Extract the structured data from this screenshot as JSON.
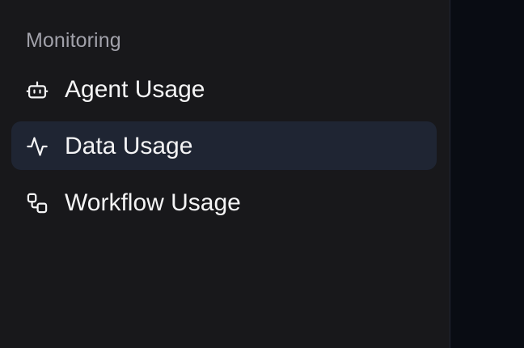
{
  "sidebar": {
    "section_label": "Monitoring",
    "items": [
      {
        "label": "Agent Usage",
        "icon": "bot-icon",
        "active": false
      },
      {
        "label": "Data Usage",
        "icon": "activity-icon",
        "active": true
      },
      {
        "label": "Workflow Usage",
        "icon": "workflow-icon",
        "active": false
      }
    ]
  },
  "colors": {
    "sidebar_bg": "#18181b",
    "main_bg": "#090c13",
    "active_item_bg": "#1f2533",
    "section_label": "#a1a1aa",
    "item_text": "#f4f4f5"
  }
}
